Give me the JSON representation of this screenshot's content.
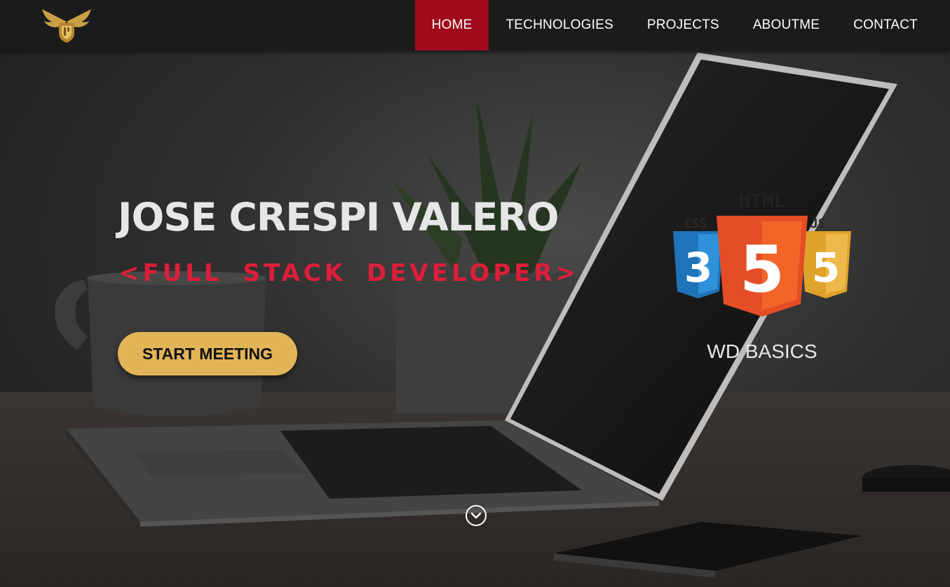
{
  "nav": {
    "logo_icon": "winged-shield-logo-icon",
    "items": [
      {
        "label": "HOME",
        "active": true
      },
      {
        "label": "TECHNOLOGIES",
        "active": false
      },
      {
        "label": "PROJECTS",
        "active": false
      },
      {
        "label": "ABOUTME",
        "active": false
      },
      {
        "label": "CONTACT",
        "active": false
      }
    ]
  },
  "hero": {
    "name": "JOSE CRESPI VALERO",
    "role": "<FULL  STACK  DEVELOPER>",
    "cta_label": "START MEETING",
    "background_icon": "laptop-desk-photo",
    "scroll_icon": "chevron-down-circle-icon"
  },
  "tech": {
    "logo_icon": "html-css-js-logo-icon",
    "logo_labels": {
      "html": "HTML",
      "css": "CSS",
      "js": "JS"
    },
    "logo_numbers": {
      "css": "3",
      "html": "5",
      "js": "5"
    },
    "caption": "WD BASICS"
  },
  "colors": {
    "nav_background": "#1b1b1b",
    "nav_active": "#a00a1c",
    "role_text": "#dc1e3a",
    "cta_background": "#e2b458",
    "html_orange": "#e44d26",
    "css_blue": "#1f73b8",
    "js_yellow": "#dfa22b"
  }
}
